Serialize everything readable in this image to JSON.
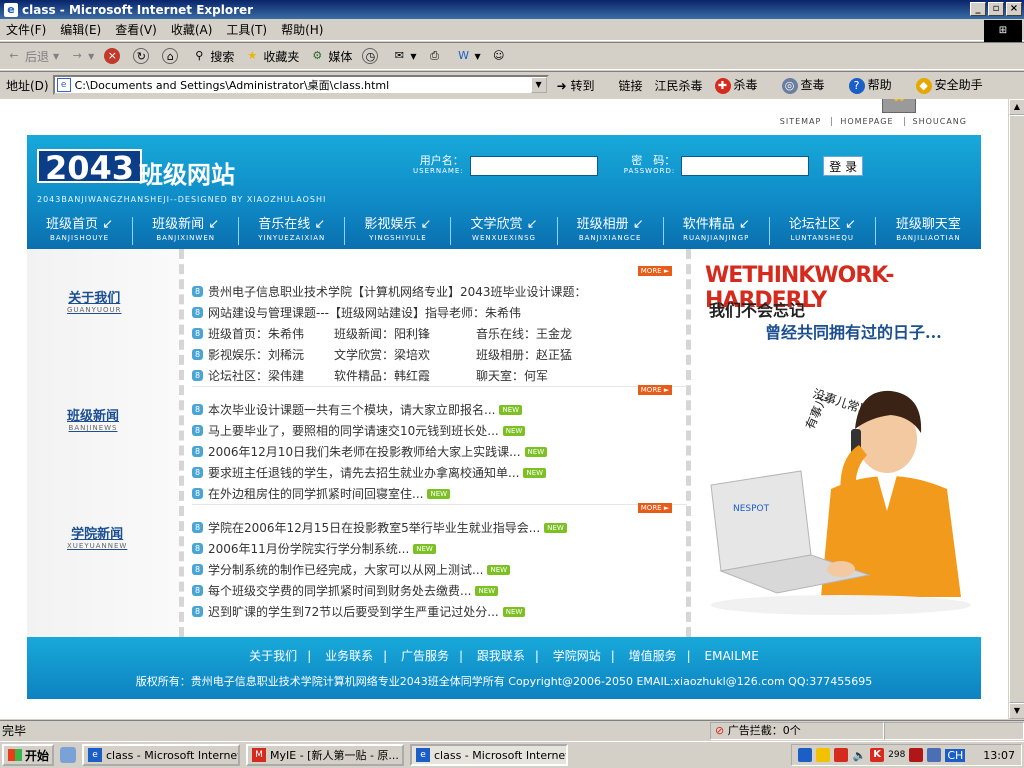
{
  "window": {
    "title": "class - Microsoft Internet Explorer",
    "buttons": [
      "_",
      "▫",
      "×"
    ]
  },
  "menu": [
    "文件(F)",
    "编辑(E)",
    "查看(V)",
    "收藏(A)",
    "工具(T)",
    "帮助(H)"
  ],
  "toolbar": {
    "back": "后退",
    "search": "搜索",
    "favorites": "收藏夹",
    "media": "媒体"
  },
  "address": {
    "label": "地址(D)",
    "value": "C:\\Documents and Settings\\Administrator\\桌面\\class.html",
    "go": "转到",
    "links": "链接",
    "extras": [
      "江民杀毒",
      "杀毒",
      "查毒",
      "帮助",
      "安全助手"
    ]
  },
  "page": {
    "toplinks": [
      "SITEMAP",
      "HOMEPAGE",
      "SHOUCANG"
    ],
    "logo_num": "2043",
    "site_title": "班级网站",
    "subline": "2043BANJIWANGZHANSHEJI--DESIGNED BY XIAOZHULAOSHI",
    "login": {
      "user_label": "用户名：",
      "user_en": "USERNAME:",
      "pass_label": "密　码：",
      "pass_en": "PASSWORD:",
      "button": "登 录"
    },
    "nav": [
      {
        "cn": "班级首页",
        "en": "BANJISHOUYE"
      },
      {
        "cn": "班级新闻",
        "en": "BANJIXINWEN"
      },
      {
        "cn": "音乐在线",
        "en": "YINYUEZAIXIAN"
      },
      {
        "cn": "影视娱乐",
        "en": "YINGSHIYULE"
      },
      {
        "cn": "文学欣赏",
        "en": "WENXUEXINSG"
      },
      {
        "cn": "班级相册",
        "en": "BANJIXIANGCE"
      },
      {
        "cn": "软件精品",
        "en": "RUANJIANJINGP"
      },
      {
        "cn": "论坛社区",
        "en": "LUNTANSHEQU"
      },
      {
        "cn": "班级聊天室",
        "en": "BANJILIAOTIAN"
      }
    ],
    "more_label": "MORE ►",
    "new_label": "NEW",
    "sections": [
      {
        "cn": "关于我们",
        "en": "GUANYUOUR"
      },
      {
        "cn": "班级新闻",
        "en": "BANJINEWS"
      },
      {
        "cn": "学院新闻",
        "en": "XUEYUANNEW"
      }
    ],
    "about": {
      "line1": "贵州电子信息职业技术学院【计算机网络专业】2043班毕业设计课题：",
      "line2": "网站建设与管理课题---【班级网站建设】指导老师：朱希伟",
      "grid": [
        [
          "班级首页：朱希伟",
          "班级新闻：阳利锋",
          "音乐在线：王金龙"
        ],
        [
          "影视娱乐：刘稀沅",
          "文学欣赏：梁培欢",
          "班级相册：赵正猛"
        ],
        [
          "论坛社区：梁伟建",
          "软件精品：韩红霞",
          "聊天室：何军"
        ]
      ]
    },
    "class_news": [
      "本次毕业设计课题一共有三个模块，请大家立即报名...",
      "马上要毕业了，要照相的同学请速交10元钱到班长处...",
      "2006年12月10日我们朱老师在投影教师给大家上实践课...",
      "要求班主任退钱的学生，请先去招生就业办拿离校通知单...",
      "在外边租房住的同学抓紧时间回寝室住..."
    ],
    "college_news": [
      "学院在2006年12月15日在投影教室5举行毕业生就业指导会...",
      "2006年11月份学院实行学分制系统...",
      "学分制系统的制作已经完成，大家可以从网上测试...",
      "每个班级交学费的同学抓紧时间到财务处去缴费...",
      "迟到旷课的学生到72节以后要受到学生严重记过处分..."
    ],
    "promo": {
      "slogan": "WETHINKWORK-HARDERLY",
      "cn1": "我们不会忘记",
      "cn2": "曾经共同拥有过的日子...",
      "cn3": "没事儿常联系啊...",
      "cn4": "有事儿",
      "brand": "NESPOT"
    },
    "footer_links": [
      "关于我们",
      "业务联系",
      "广告服务",
      "跟我联系",
      "学院网站",
      "增值服务",
      "EMAILME"
    ],
    "copyright": "版权所有：贵州电子信息职业技术学院计算机网络专业2043班全体同学所有 Copyright@2006-2050 EMAIL:xiaozhukl@126.com QQ:377455695"
  },
  "status": {
    "text": "完毕",
    "adblock": "广告拦截：0个"
  },
  "taskbar": {
    "start": "开始",
    "tasks": [
      "class - Microsoft Internet ...",
      "MyIE - [新人第一贴 - 原...",
      "class - Microsoft Internet ..."
    ],
    "tray_num": "298",
    "lang": "CH",
    "clock": "13:07"
  },
  "colors": {
    "header_blue": "#18a9d9",
    "brand_red": "#d52b1e",
    "more_orange": "#e85c1a",
    "new_green": "#7cc023"
  }
}
